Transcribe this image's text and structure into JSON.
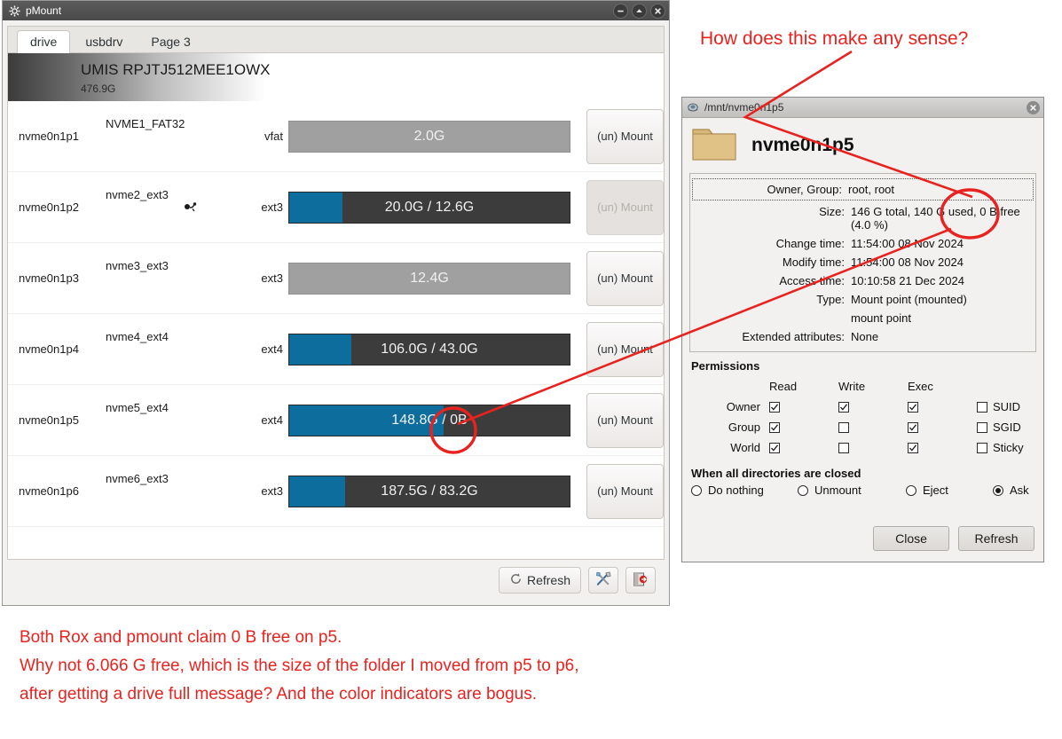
{
  "pmount": {
    "title": "pMount",
    "window_icon": "gear-icon",
    "window_buttons": [
      {
        "name": "minimize-button",
        "glyph": "minimize-icon"
      },
      {
        "name": "maximize-button",
        "glyph": "maximize-icon"
      },
      {
        "name": "close-button",
        "glyph": "close-icon"
      }
    ],
    "tabs": [
      {
        "label": "drive",
        "active": true
      },
      {
        "label": "usbdrv",
        "active": false
      },
      {
        "label": "Page 3",
        "active": false
      }
    ],
    "drive": {
      "model": "UMIS RPJTJ512MEE1OWX",
      "capacity": "476.9G"
    },
    "mount_button_label": "(un) Mount",
    "partitions": [
      {
        "device": "nvme0n1p1",
        "label": "NVME1_FAT32",
        "fstype": "vfat",
        "bar_text": "2.0G",
        "mounted": false,
        "fill_percent": 0,
        "button_disabled": false,
        "indicator": false
      },
      {
        "device": "nvme0n1p2",
        "label": "nvme2_ext3",
        "fstype": "ext3",
        "bar_text": "20.0G / 12.6G",
        "mounted": true,
        "fill_percent": 19,
        "button_disabled": true,
        "indicator": true
      },
      {
        "device": "nvme0n1p3",
        "label": "nvme3_ext3",
        "fstype": "ext3",
        "bar_text": "12.4G",
        "mounted": false,
        "fill_percent": 0,
        "button_disabled": false,
        "indicator": false
      },
      {
        "device": "nvme0n1p4",
        "label": "nvme4_ext4",
        "fstype": "ext4",
        "bar_text": "106.0G / 43.0G",
        "mounted": true,
        "fill_percent": 22,
        "button_disabled": false,
        "indicator": false
      },
      {
        "device": "nvme0n1p5",
        "label": "nvme5_ext4",
        "fstype": "ext4",
        "bar_text": "148.8G / 0B",
        "mounted": true,
        "fill_percent": 55,
        "button_disabled": false,
        "indicator": false
      },
      {
        "device": "nvme0n1p6",
        "label": "nvme6_ext3",
        "fstype": "ext3",
        "bar_text": "187.5G / 83.2G",
        "mounted": true,
        "fill_percent": 20,
        "button_disabled": false,
        "indicator": false
      }
    ],
    "toolbar": {
      "refresh_label": "Refresh",
      "refresh_icon": "refresh-icon",
      "tools_icon": "tools-icon",
      "exit_icon": "exit-icon"
    }
  },
  "dialog": {
    "title": "/mnt/nvme0n1p5",
    "title_icon": "properties-icon",
    "close_icon": "close-icon",
    "folder_icon": "folder-icon",
    "heading": "nvme0n1p5",
    "info": [
      {
        "key": "Owner, Group:",
        "value": "root, root"
      },
      {
        "key": "Size:",
        "value": "146 G total, 140 G used, 0 B free (4.0 %)"
      },
      {
        "key": "Change time:",
        "value": "11:54:00 08 Nov 2024"
      },
      {
        "key": "Modify time:",
        "value": "11:54:00 08 Nov 2024"
      },
      {
        "key": "Access time:",
        "value": "10:10:58 21 Dec 2024"
      },
      {
        "key": "Type:",
        "value": "Mount point (mounted)"
      },
      {
        "key": "",
        "value": "mount point"
      },
      {
        "key": "Extended attributes:",
        "value": "None"
      }
    ],
    "permissions": {
      "title": "Permissions",
      "columns": [
        "Read",
        "Write",
        "Exec"
      ],
      "rows": [
        {
          "label": "Owner",
          "read": true,
          "write": true,
          "exec": true
        },
        {
          "label": "Group",
          "read": true,
          "write": false,
          "exec": true
        },
        {
          "label": "World",
          "read": true,
          "write": false,
          "exec": true
        }
      ],
      "flags": [
        {
          "label": "SUID",
          "checked": false
        },
        {
          "label": "SGID",
          "checked": false
        },
        {
          "label": "Sticky",
          "checked": false
        }
      ]
    },
    "when_closed": {
      "title": "When all directories are closed",
      "options": [
        {
          "label": "Do nothing",
          "selected": false
        },
        {
          "label": "Unmount",
          "selected": false
        },
        {
          "label": "Eject",
          "selected": false
        },
        {
          "label": "Ask",
          "selected": true
        }
      ]
    },
    "buttons": [
      {
        "label": "Close",
        "name": "close-button"
      },
      {
        "label": "Refresh",
        "name": "refresh-button"
      }
    ]
  },
  "annotations": {
    "color": "#e8231f",
    "top_text": "How does this make any sense?",
    "bottom_lines": [
      "Both Rox and pmount claim 0 B free on p5.",
      "Why not 6.066 G free, which is the size of the folder I moved from p5 to p6,",
      "after getting a drive full message? And the color indicators are bogus."
    ]
  }
}
